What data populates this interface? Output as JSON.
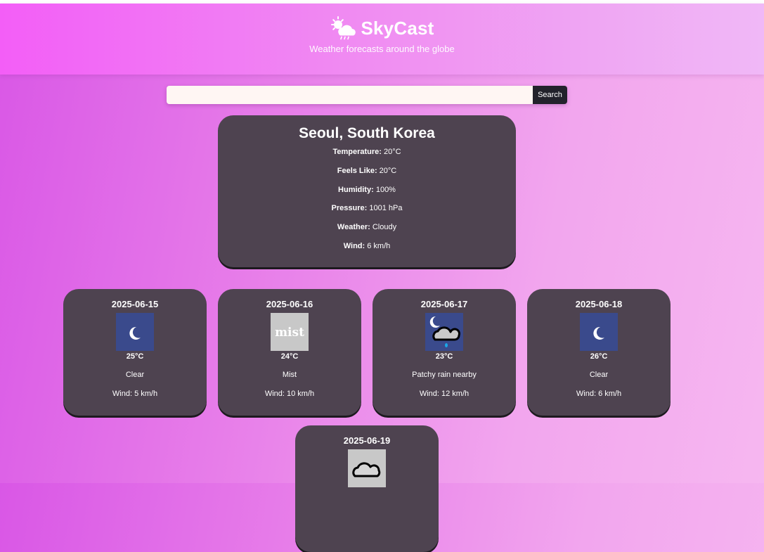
{
  "header": {
    "brand_icon": "weather-cloud-sun-rain-icon",
    "title": "SkyCast",
    "tagline": "Weather forecasts around the globe"
  },
  "search": {
    "value": "",
    "placeholder": "",
    "button_label": "Search"
  },
  "current": {
    "location": "Seoul, South Korea",
    "details": [
      {
        "label": "Temperature:",
        "value": "20°C"
      },
      {
        "label": "Feels Like:",
        "value": "20°C"
      },
      {
        "label": "Humidity:",
        "value": "100%"
      },
      {
        "label": "Pressure:",
        "value": "1001 hPa"
      },
      {
        "label": "Weather:",
        "value": "Cloudy"
      },
      {
        "label": "Wind:",
        "value": "6 km/h"
      }
    ]
  },
  "forecast": [
    {
      "date": "2025-06-15",
      "icon": "moon-clear-icon",
      "temp": "25°C",
      "condition": "Clear",
      "wind": "Wind: 5 km/h"
    },
    {
      "date": "2025-06-16",
      "icon": "mist-icon",
      "icon_text": "mist",
      "temp": "24°C",
      "condition": "Mist",
      "wind": "Wind: 10 km/h"
    },
    {
      "date": "2025-06-17",
      "icon": "moon-cloud-rain-icon",
      "temp": "23°C",
      "condition": "Patchy rain nearby",
      "wind": "Wind: 12 km/h"
    },
    {
      "date": "2025-06-18",
      "icon": "moon-clear-icon",
      "temp": "26°C",
      "condition": "Clear",
      "wind": "Wind: 6 km/h"
    },
    {
      "date": "2025-06-19",
      "icon": "cloud-icon",
      "temp": "",
      "condition": "",
      "wind": ""
    }
  ],
  "colors": {
    "card_bg": "#4e4350",
    "header_gradient_start": "#f35ef7",
    "button_bg": "#22222b",
    "clear_icon_bg": "#3a4a8c"
  }
}
